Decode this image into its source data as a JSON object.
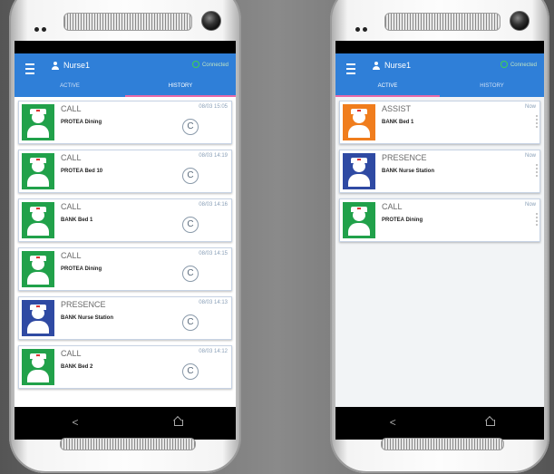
{
  "colors": {
    "topbar": "#2f7fd8",
    "tab_indicator": "#e86aa8",
    "call": "#21a14a",
    "presence": "#2f4aa3",
    "assist": "#f07d1d",
    "connected": "#3fd24f"
  },
  "phones": [
    {
      "user": "Nurse1",
      "status": "Connected",
      "tabs": [
        {
          "label": "ACTIVE",
          "selected": false
        },
        {
          "label": "HISTORY",
          "selected": true
        }
      ],
      "items": [
        {
          "title": "CALL",
          "location": "PROTEA Dining",
          "time": "08/03  15:05",
          "type": "call",
          "badge": "C"
        },
        {
          "title": "CALL",
          "location": "PROTEA Bed 10",
          "time": "08/03  14:19",
          "type": "call",
          "badge": "C"
        },
        {
          "title": "CALL",
          "location": "BANK Bed 1",
          "time": "08/03  14:16",
          "type": "call",
          "badge": "C"
        },
        {
          "title": "CALL",
          "location": "PROTEA Dining",
          "time": "08/03  14:15",
          "type": "call",
          "badge": "C"
        },
        {
          "title": "PRESENCE",
          "location": "BANK Nurse Station",
          "time": "08/03  14:13",
          "type": "presence",
          "badge": "C"
        },
        {
          "title": "CALL",
          "location": "BANK Bed 2",
          "time": "08/03  14:12",
          "type": "call",
          "badge": "C"
        }
      ],
      "nav": {
        "back": "<",
        "home": "home-icon"
      }
    },
    {
      "user": "Nurse1",
      "status": "Connected",
      "tabs": [
        {
          "label": "ACTIVE",
          "selected": true
        },
        {
          "label": "HISTORY",
          "selected": false
        }
      ],
      "items": [
        {
          "title": "ASSIST",
          "location": "BANK Bed 1",
          "time": "Now",
          "type": "assist"
        },
        {
          "title": "PRESENCE",
          "location": "BANK Nurse Station",
          "time": "Now",
          "type": "presence"
        },
        {
          "title": "CALL",
          "location": "PROTEA Dining",
          "time": "Now",
          "type": "call"
        }
      ],
      "nav": {
        "back": "<",
        "home": "home-icon"
      }
    }
  ]
}
